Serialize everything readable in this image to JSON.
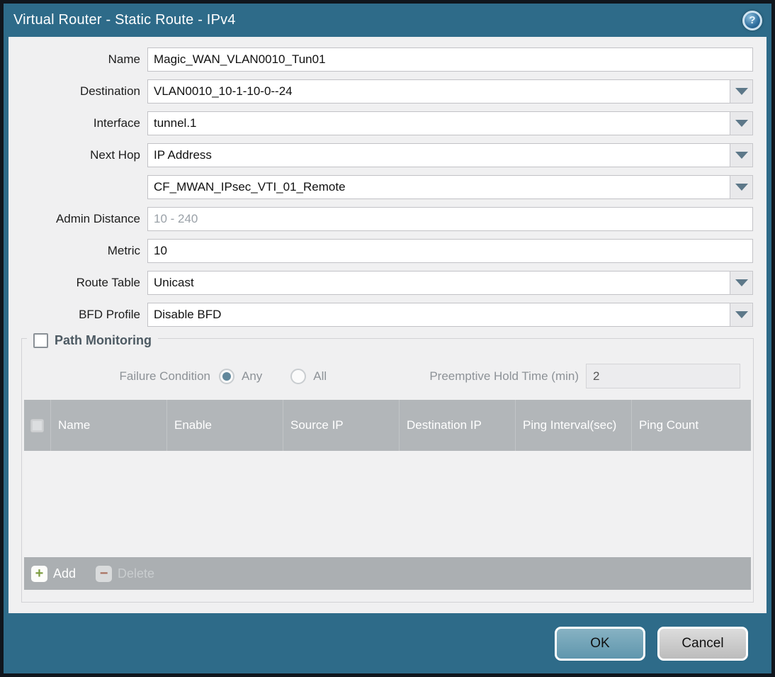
{
  "titlebar": {
    "title": "Virtual Router - Static Route - IPv4",
    "help_glyph": "?"
  },
  "form": {
    "name": {
      "label": "Name",
      "value": "Magic_WAN_VLAN0010_Tun01"
    },
    "destination": {
      "label": "Destination",
      "value": "VLAN0010_10-1-10-0--24"
    },
    "interface": {
      "label": "Interface",
      "value": "tunnel.1"
    },
    "next_hop": {
      "label": "Next Hop",
      "value": "IP Address"
    },
    "next_hop_address": {
      "value": "CF_MWAN_IPsec_VTI_01_Remote"
    },
    "admin_distance": {
      "label": "Admin Distance",
      "value": "",
      "placeholder": "10 - 240"
    },
    "metric": {
      "label": "Metric",
      "value": "10"
    },
    "route_table": {
      "label": "Route Table",
      "value": "Unicast"
    },
    "bfd_profile": {
      "label": "BFD Profile",
      "value": "Disable BFD"
    }
  },
  "path_monitoring": {
    "title": "Path Monitoring",
    "enabled": false,
    "failure_condition": {
      "label": "Failure Condition",
      "options": [
        {
          "label": "Any",
          "selected": true
        },
        {
          "label": "All",
          "selected": false
        }
      ]
    },
    "preemptive_hold_time": {
      "label": "Preemptive Hold Time (min)",
      "value": "2"
    },
    "table": {
      "columns": [
        "Name",
        "Enable",
        "Source IP",
        "Destination IP",
        "Ping Interval(sec)",
        "Ping Count"
      ],
      "rows": []
    },
    "toolbar": {
      "add_label": "Add",
      "add_glyph": "+",
      "delete_label": "Delete",
      "delete_glyph": "−"
    }
  },
  "footer": {
    "ok_label": "OK",
    "cancel_label": "Cancel"
  },
  "colors": {
    "titlebar_teal": "#2e6b89",
    "outer_border": "#10161d",
    "content_bg": "#f0f0f1",
    "table_header_bg": "#b2b6b9",
    "ok_button": "#6fa3b8",
    "add_plus_green": "#7d9c40",
    "delete_minus_red": "#a8705f",
    "radio_selected_dot": "#62889c"
  }
}
